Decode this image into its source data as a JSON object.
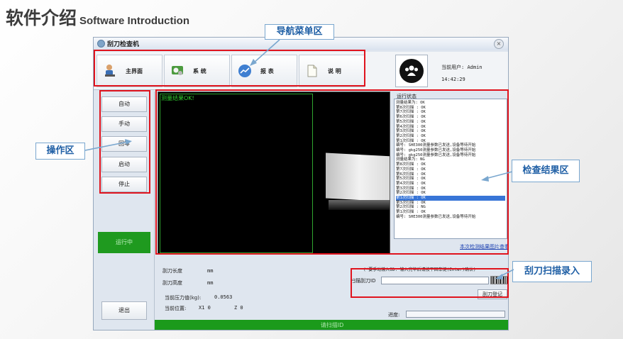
{
  "slide": {
    "title_cn": "软件介绍",
    "title_en": "Software Introduction"
  },
  "window": {
    "title": "刮刀检查机",
    "close_glyph": "×"
  },
  "nav": {
    "items": [
      {
        "label": "主界面",
        "icon": "person-icon"
      },
      {
        "label": "系 统",
        "icon": "system-gear-icon"
      },
      {
        "label": "报 表",
        "icon": "report-chart-icon"
      },
      {
        "label": "说 明",
        "icon": "document-icon"
      }
    ],
    "user_label": "当前用户:",
    "user_name": "Admin",
    "time": "14:42:29"
  },
  "sidebar": {
    "buttons": [
      "自动",
      "手动",
      "回零",
      "启动",
      "停止"
    ],
    "run_status": "运行中",
    "exit_label": "退出"
  },
  "camera": {
    "overlay_text": "测量结果OK!"
  },
  "run_status_panel": {
    "legend": "运行状态",
    "lines": [
      "测量结果为: OK",
      "第8次扫描 : OK",
      "第7次扫描 : OK",
      "第6次扫描 : OK",
      "第5次扫描 : OK",
      "第4次扫描 : OK",
      "第3次扫描 : OK",
      "第2次扫描 : OK",
      "第1次扫描 : OK",
      "编号: SHE300测量参数已发送,设备等待开始",
      "编号: gkg250测量参数已发送,设备等待开始",
      "编号: gkg250测量参数已发送,设备等待开始",
      "测量结果为: NG",
      "第8次扫描 : OK",
      "第7次扫描 : OK",
      "第6次扫描 : OK",
      "第5次扫描 : OK",
      "第4次扫描 : OK",
      "第3次扫描 : OK",
      "第2次扫描 : OK",
      "第1次扫描 : OK",
      "第3次扫描 : OK",
      "第2次扫描 : NG",
      "第1次扫描 : OK",
      "编号: SHE300测量参数已发送,设备等待开始"
    ],
    "selected_index": 20,
    "image_link": "本次检测结果图片查看"
  },
  "bottom": {
    "blade_length_label": "刮刀长度",
    "blade_length_unit": "mm",
    "blade_height_label": "刮刀高度",
    "blade_height_unit": "mm",
    "pressure_label": "当前压力值(kg):",
    "pressure_value": "0.0563",
    "position_label": "当前位置:",
    "x_value": "X1 0",
    "z_value": "Z 0",
    "scan_hint": "(*要手动输入ID: 输入完毕后请按下回车键(Enter)确认)",
    "scan_label": "扫描刮刀ID",
    "register_button": "刮刀登记",
    "progress_label": "进度:",
    "status_text": "请扫描ID"
  },
  "callouts": {
    "nav": "导航菜单区",
    "operation": "操作区",
    "results": "检查结果区",
    "scan": "刮刀扫描录入"
  },
  "colors": {
    "callout_border": "#e0141e",
    "callout_text": "#1f5fa5",
    "status_green": "#1b9a1b",
    "selection_blue": "#3875d7"
  }
}
